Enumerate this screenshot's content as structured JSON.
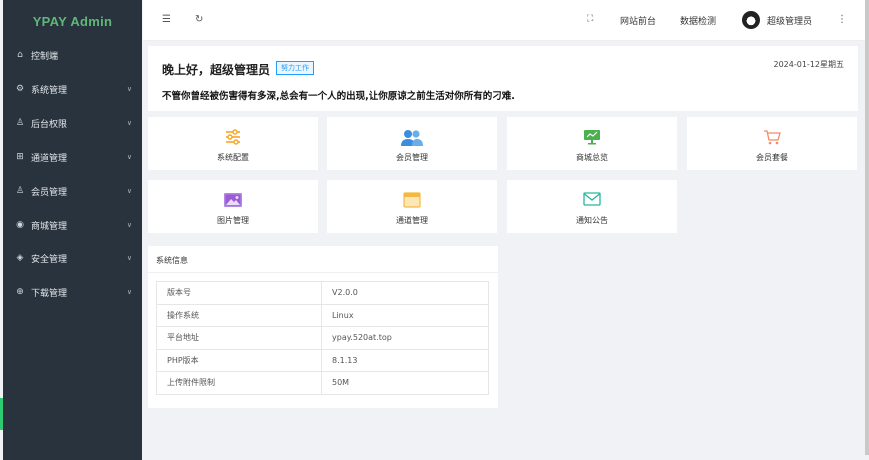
{
  "app": {
    "title": "YPAY Admin"
  },
  "sidebar": {
    "items": [
      {
        "label": "控制端",
        "icon": "home-icon"
      },
      {
        "label": "系统管理",
        "icon": "gear-icon"
      },
      {
        "label": "后台权限",
        "icon": "user-icon"
      },
      {
        "label": "通道管理",
        "icon": "channel-icon"
      },
      {
        "label": "会员管理",
        "icon": "user-icon"
      },
      {
        "label": "商城管理",
        "icon": "target-icon"
      },
      {
        "label": "安全管理",
        "icon": "diamond-icon"
      },
      {
        "label": "下载管理",
        "icon": "download-icon"
      }
    ]
  },
  "header": {
    "links": [
      "网站前台",
      "数据检测"
    ],
    "username": "超级管理员"
  },
  "welcome": {
    "greeting": "晚上好，超级管理员",
    "badge": "努力工作",
    "date": "2024-01-12星期五",
    "motto": "不管你曾经被伤害得有多深,总会有一个人的出现,让你原谅之前生活对你所有的刁难."
  },
  "shortcuts": [
    {
      "label": "系统配置",
      "icon": "sliders-icon",
      "color": "#f5a623"
    },
    {
      "label": "会员管理",
      "icon": "users-icon",
      "color": "#3b8ede"
    },
    {
      "label": "商城总览",
      "icon": "monitor-icon",
      "color": "#4caf50"
    },
    {
      "label": "会员套餐",
      "icon": "cart-icon",
      "color": "#f28a6b"
    },
    {
      "label": "图片管理",
      "icon": "image-icon",
      "color": "#9c5bd6"
    },
    {
      "label": "通道管理",
      "icon": "window-icon",
      "color": "#f5b942"
    },
    {
      "label": "通知公告",
      "icon": "mail-icon",
      "color": "#26b6a0"
    }
  ],
  "system_info": {
    "title": "系统信息",
    "rows": [
      {
        "key": "版本号",
        "value": "V2.0.0"
      },
      {
        "key": "操作系统",
        "value": "Linux"
      },
      {
        "key": "平台地址",
        "value": "ypay.520at.top"
      },
      {
        "key": "PHP版本",
        "value": "8.1.13"
      },
      {
        "key": "上传附件限制",
        "value": "50M"
      }
    ]
  }
}
